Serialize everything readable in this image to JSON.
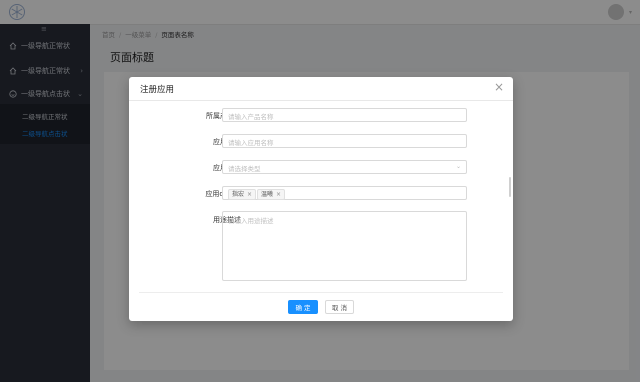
{
  "colors": {
    "sidebar_bg": "#2b2f3a",
    "accent": "#1890ff"
  },
  "header": {
    "logo_icon": "snowflake-logo-icon",
    "avatar_icon": "user-avatar"
  },
  "sidebar": {
    "collapse_icon": "menu-fold-icon",
    "items": [
      {
        "label": "一级导航正常状",
        "icon": "home-icon"
      },
      {
        "label": "一级导航正常状",
        "icon": "home-icon",
        "chevron": "›"
      },
      {
        "label": "一级导航点击状",
        "icon": "smile-icon",
        "chevron": "⌄"
      }
    ],
    "submenu": [
      {
        "label": "二级导航正常状"
      },
      {
        "label": "二级导航点击状"
      }
    ]
  },
  "breadcrumb": {
    "items": [
      "首页",
      "一级菜单",
      "页面表名称"
    ]
  },
  "page": {
    "title": "页面标题"
  },
  "modal": {
    "title": "注册应用",
    "close": "×",
    "fields": [
      {
        "label": "所属产品线",
        "placeholder": "请输入产品名称"
      },
      {
        "label": "应用名称",
        "placeholder": "请输入应用名称"
      },
      {
        "label": "应用类型",
        "placeholder": "请选择类型"
      },
      {
        "label": "应用owner",
        "tags": [
          "指宏",
          "温曦"
        ]
      },
      {
        "label": "用途描述",
        "placeholder": "请输入用途描述"
      }
    ],
    "ok_label": "确 定",
    "cancel_label": "取 消"
  }
}
